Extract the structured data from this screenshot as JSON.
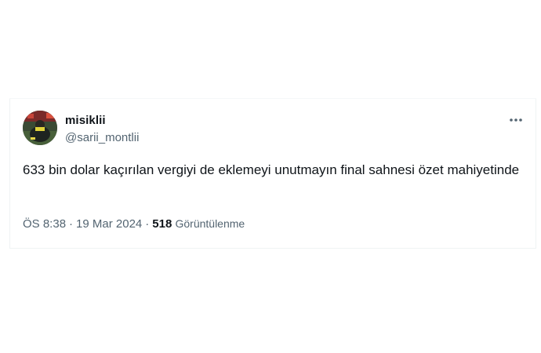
{
  "tweet": {
    "display_name": "misiklii",
    "handle": "@sarii_montlii",
    "text": "633 bin dolar kaçırılan vergiyi de eklemeyi unutmayın final sahnesi özet mahiyetinde",
    "time": "ÖS 8:38",
    "separator": "·",
    "date": "19 Mar 2024",
    "views_count": "518",
    "views_label": "Görüntülenme",
    "avatar_icon": "profile-photo",
    "more_icon": "more-dots-icon"
  },
  "colors": {
    "primary_text": "#0f1419",
    "secondary_text": "#536471",
    "border": "#eff3f4"
  }
}
